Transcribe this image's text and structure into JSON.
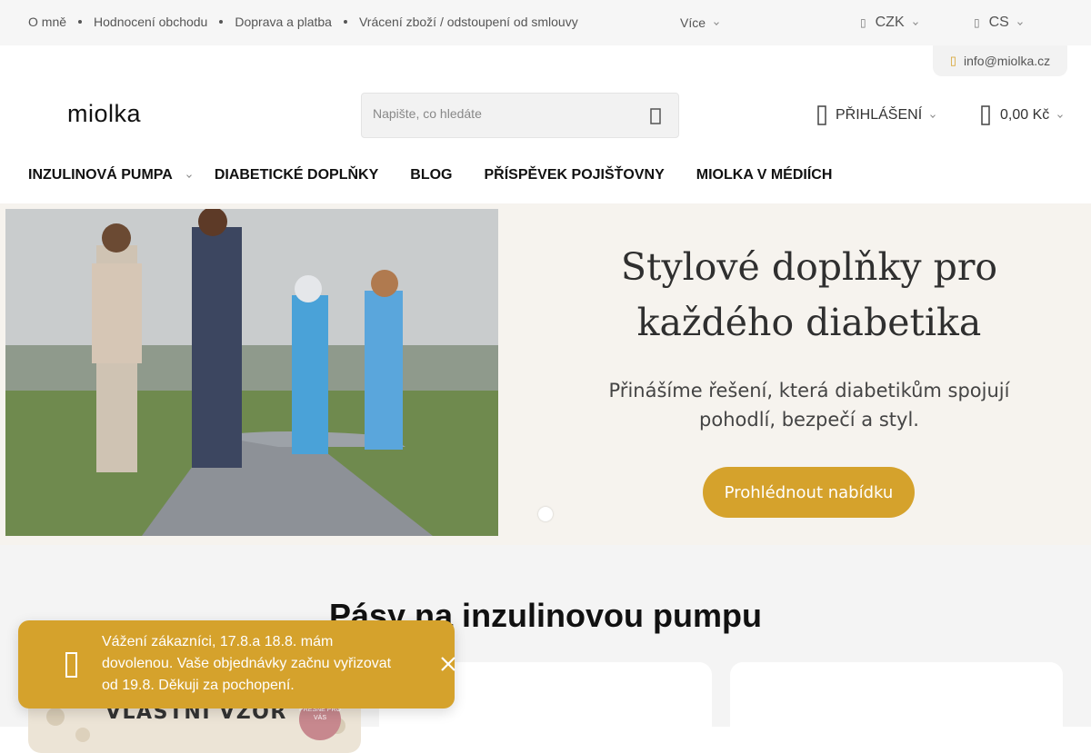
{
  "topbar": {
    "links": [
      "O mně",
      "Hodnocení obchodu",
      "Doprava a platba",
      "Vrácení zboží / odstoupení od smlouvy"
    ],
    "more_label": "Více",
    "currency": "CZK",
    "language": "CS",
    "email": "info@miolka.cz"
  },
  "header": {
    "logo": "miolka",
    "search_placeholder": "Napište, co hledáte",
    "login_label": "PŘIHLÁŠENÍ",
    "cart_total": "0,00 Kč"
  },
  "nav": {
    "items": [
      "INZULINOVÁ PUMPA",
      "DIABETICKÉ DOPLŇKY",
      "BLOG",
      "PŘÍSPĚVEK POJIŠŤOVNY",
      "MIOLKA V MÉDIÍCH"
    ]
  },
  "hero": {
    "title_line1": "Stylové doplňky pro",
    "title_line2": "každého diabetika",
    "subtitle_line1": "Přinášíme řešení, která diabetikům spojují",
    "subtitle_line2": "pohodlí, bezpečí a styl.",
    "cta": "Prohlédnout nabídku"
  },
  "section": {
    "title": "Pásy na inzulinovou pumpu"
  },
  "product_cards": [
    {
      "banner_text": "VLASTNÍ VZOR",
      "badge_text": "PŘESNÉ PRO VÁS"
    },
    {},
    {}
  ],
  "toast": {
    "message": "Vážení zákazníci, 17.8.a 18.8. mám dovolenou. Vaše objednávky začnu vyřizovat od 19.8. Děkuji za pochopení."
  },
  "colors": {
    "accent": "#d5a22c",
    "topbar_bg": "#f6f6f6",
    "hero_bg": "#f6f3ee"
  }
}
